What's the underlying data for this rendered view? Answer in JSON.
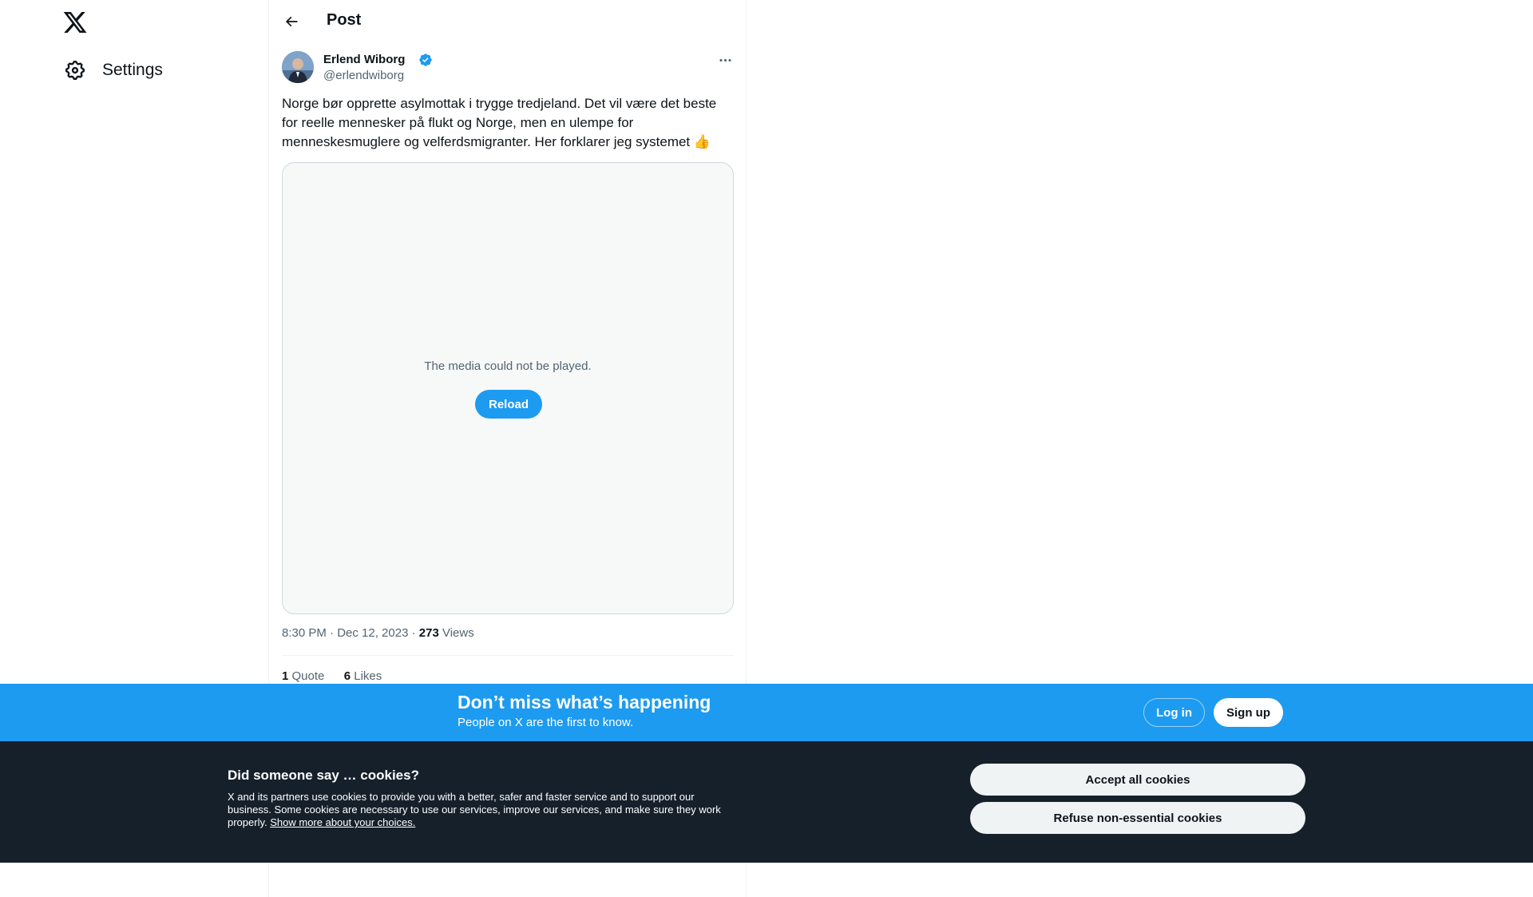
{
  "nav": {
    "logo_icon": "x-logo-icon",
    "settings_label": "Settings",
    "settings_icon": "gear-icon"
  },
  "header": {
    "back_icon": "arrow-left-icon",
    "title": "Post"
  },
  "post": {
    "author_name": "Erlend Wiborg",
    "author_handle": "@erlendwiborg",
    "verified_icon": "verified-badge-icon",
    "more_icon": "more-horizontal-icon",
    "text": "Norge bør opprette asylmottak i trygge tredjeland. Det vil være det beste for reelle mennesker på flukt og Norge, men en ulempe for menneskesmuglere og velferdsmigranter. Her forklarer jeg systemet 👍",
    "media": {
      "error_text": "The media could not be played.",
      "reload_label": "Reload"
    },
    "time": "8:30 PM · Dec 12, 2023",
    "separator": " · ",
    "views_count": "273",
    "views_label": "Views",
    "quotes_count": "1",
    "quotes_label": "Quote",
    "likes_count": "6",
    "likes_label": "Likes"
  },
  "promo": {
    "title": "Don’t miss what’s happening",
    "subtitle": "People on X are the first to know.",
    "login_label": "Log in",
    "signup_label": "Sign up"
  },
  "cookies": {
    "title": "Did someone say … cookies?",
    "body": "X and its partners use cookies to provide you with a better, safer and faster service and to support our business. Some cookies are necessary to use our services, improve our services, and make sure they work properly. ",
    "link": "Show more about your choices.",
    "accept_label": "Accept all cookies",
    "refuse_label": "Refuse non-essential cookies"
  },
  "colors": {
    "accent": "#1d9bf0",
    "text_primary": "#0f1419",
    "text_secondary": "#536471",
    "cookie_bg": "#15202b"
  }
}
